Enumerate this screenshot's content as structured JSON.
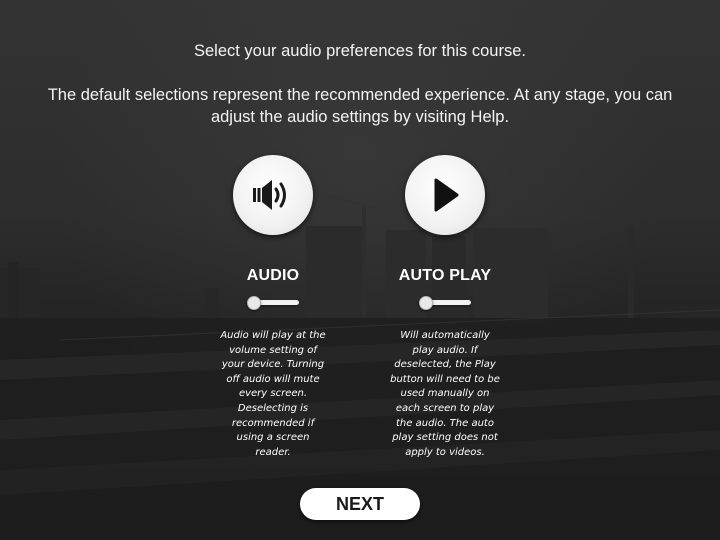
{
  "intro": {
    "line1": "Select your audio preferences for this course.",
    "line2": "The default selections represent the recommended experience. At any stage, you can adjust the audio settings by visiting Help."
  },
  "options": {
    "audio": {
      "icon": "speaker-icon",
      "title": "AUDIO",
      "toggle_on": false,
      "description": "Audio will play at the volume setting of your device. Turning off audio will mute every screen. Deselecting is recommended if using a screen reader."
    },
    "autoplay": {
      "icon": "play-icon",
      "title": "AUTO PLAY",
      "toggle_on": false,
      "description": "Will automatically play audio. If deselected, the Play button will need to be used manually on each screen to play the audio. The auto play setting does not apply to videos."
    }
  },
  "next_button": {
    "label": "NEXT"
  },
  "colors": {
    "background": "#2a2a2a",
    "text": "#ffffff",
    "button_bg": "#ffffff",
    "button_text": "#1a1a1a"
  }
}
